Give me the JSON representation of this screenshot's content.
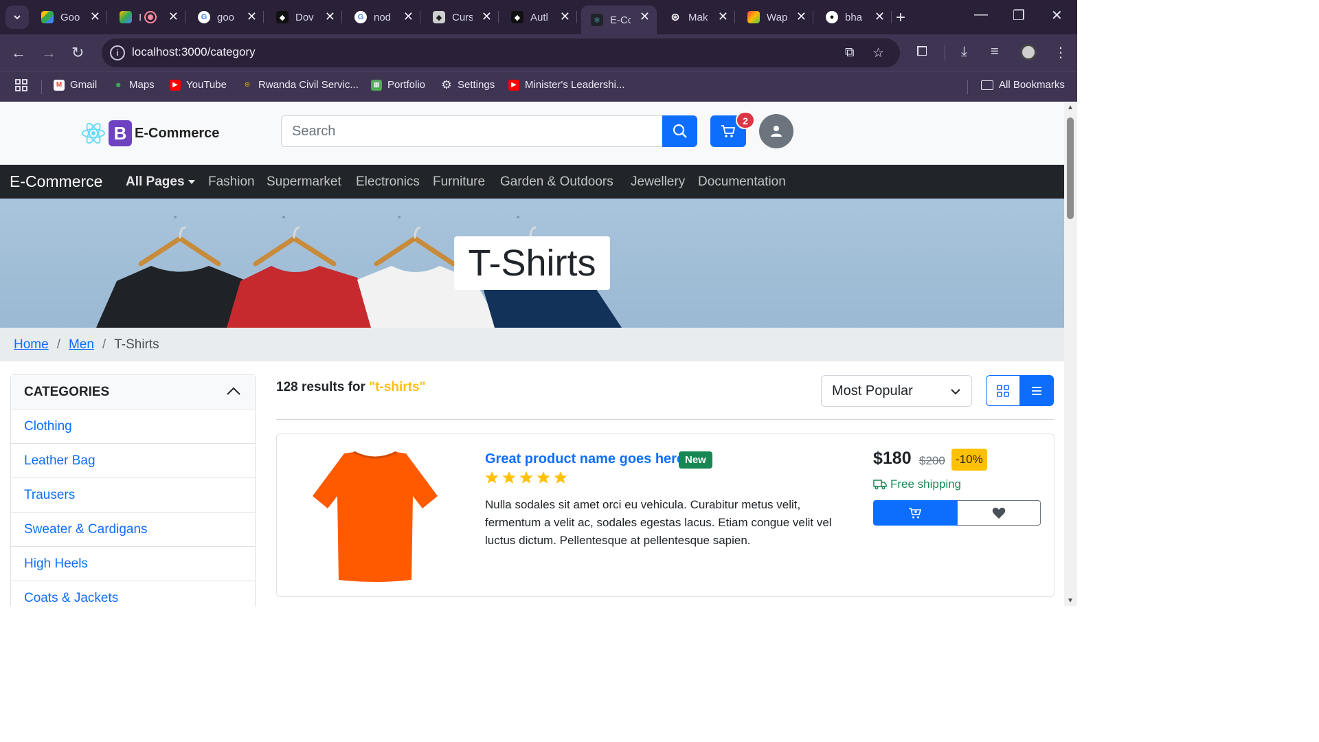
{
  "browser": {
    "tabs": [
      {
        "label": "Goo",
        "icon": "google-drive-icon"
      },
      {
        "label": "I",
        "icon": "google-meet-icon"
      },
      {
        "label": "goo",
        "icon": "google-icon"
      },
      {
        "label": "Dov",
        "icon": "cursor-icon"
      },
      {
        "label": "nod",
        "icon": "google-icon"
      },
      {
        "label": "Curs",
        "icon": "cursor-icon"
      },
      {
        "label": "Autl",
        "icon": "cursor-icon"
      },
      {
        "label": "E-Cc",
        "icon": "react-icon",
        "active": true
      },
      {
        "label": "Mak",
        "icon": "chatgpt-icon"
      },
      {
        "label": "Wap",
        "icon": "whatsapp-icon"
      },
      {
        "label": "bha",
        "icon": "github-icon"
      }
    ],
    "url": "localhost:3000/category",
    "bookmarks": [
      {
        "label": "Gmail"
      },
      {
        "label": "Maps"
      },
      {
        "label": "YouTube"
      },
      {
        "label": "Rwanda Civil Servic..."
      },
      {
        "label": "Portfolio"
      },
      {
        "label": "Settings"
      },
      {
        "label": "Minister's Leadershi..."
      }
    ],
    "all_bookmarks": "All Bookmarks"
  },
  "header": {
    "logo_text": "E-Commerce",
    "logo_letter": "B",
    "search_placeholder": "Search",
    "cart_count": "2"
  },
  "nav": {
    "brand": "E-Commerce",
    "items": [
      "All Pages",
      "Fashion",
      "Supermarket",
      "Electronics",
      "Furniture",
      "Garden & Outdoors",
      "Jewellery",
      "Documentation"
    ]
  },
  "banner": {
    "title": "T-Shirts"
  },
  "breadcrumb": {
    "items": [
      "Home",
      "Men",
      "T-Shirts"
    ],
    "separator": "/"
  },
  "sidebar": {
    "title": "CATEGORIES",
    "items": [
      "Clothing",
      "Leather Bag",
      "Trausers",
      "Sweater & Cardigans",
      "High Heels",
      "Coats & Jackets"
    ]
  },
  "results": {
    "count_text": "128 results for ",
    "query": "\"t-shirts\""
  },
  "sort": {
    "selected": "Most Popular"
  },
  "product": {
    "title": "Great product name goes here",
    "badge": "New",
    "rating": 5,
    "description": "Nulla sodales sit amet orci eu vehicula. Curabitur metus velit, fermentum a velit ac, sodales egestas lacus. Etiam congue velit vel luctus dictum. Pellentesque at pellentesque sapien.",
    "price": "$180",
    "old_price": "$200",
    "discount": "-10%",
    "shipping": "Free shipping"
  },
  "colors": {
    "primary": "#0d6efd",
    "dark": "#212529",
    "success": "#198754",
    "warning": "#ffc107",
    "danger": "#dc3545",
    "shirt": "#ff5a00"
  }
}
